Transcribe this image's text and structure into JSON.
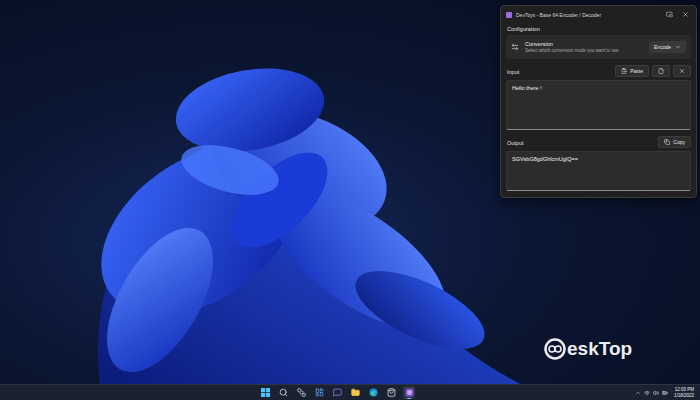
{
  "window": {
    "title": "DevToys - Base 64 Encoder / Decoder"
  },
  "configuration": {
    "heading": "Configuration",
    "conversion": {
      "title": "Conversion",
      "description": "Select which conversion mode you want to use",
      "value": "Encode"
    }
  },
  "input": {
    "label": "Input",
    "paste_button": "Paste",
    "text": "Hello there !"
  },
  "output": {
    "label": "Output",
    "copy_button": "Copy",
    "text": "SGVsbG8gdGhlcmUgIQ=="
  },
  "taskbar": {
    "apps": [
      {
        "running": false
      },
      {
        "running": false
      },
      {
        "running": false
      },
      {
        "running": false
      },
      {
        "running": false
      },
      {
        "running": false
      },
      {
        "running": false
      },
      {
        "running": false
      },
      {
        "running": true
      }
    ]
  },
  "clock": {
    "time": "12:00 PM",
    "date": "1/18/2022"
  },
  "watermark": {
    "text": "eskTop"
  }
}
